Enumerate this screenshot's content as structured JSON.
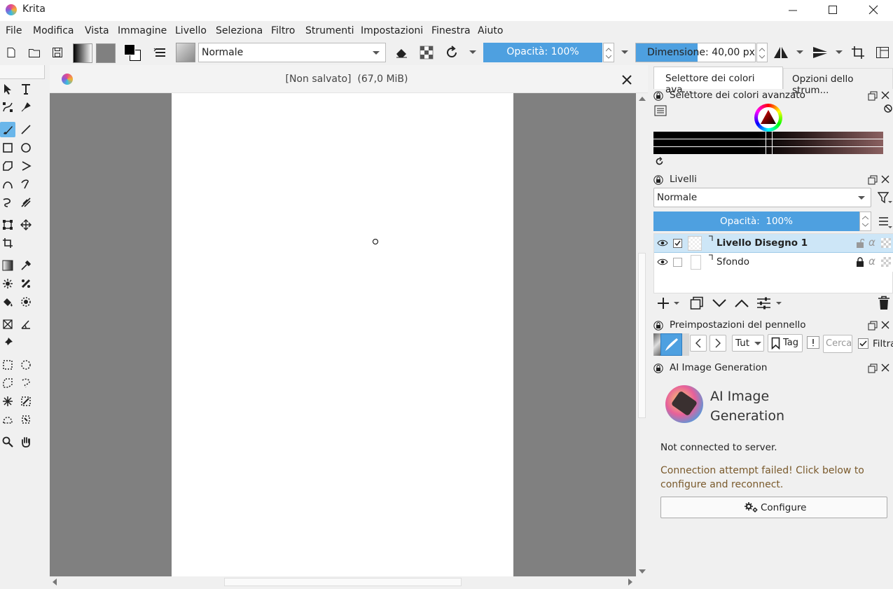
{
  "window": {
    "title": "Krita"
  },
  "menu": [
    "File",
    "Modifica",
    "Vista",
    "Immagine",
    "Livello",
    "Seleziona",
    "Filtro",
    "Strumenti",
    "Impostazioni",
    "Finestra",
    "Aiuto"
  ],
  "toolbar": {
    "blend_mode": "Normale",
    "opacity_label": "Opacità: 100%",
    "opacity_value": 1.0,
    "size_label": "Dimensione: 40,00 px"
  },
  "document": {
    "title": "[Non salvato]  (67,0 MiB)"
  },
  "dock_tabs": [
    "Selettore dei colori ava...",
    "Opzioni dello strum..."
  ],
  "color_selector": {
    "title": "Selettore dei colori avanzato"
  },
  "layers": {
    "title": "Livelli",
    "blend_mode": "Normale",
    "opacity_label": "Opacità:  100%",
    "items": [
      {
        "name": "Livello Disegno 1",
        "selected": true
      },
      {
        "name": "Sfondo",
        "selected": false
      }
    ]
  },
  "brush_presets": {
    "title": "Preimpostazioni del pennello",
    "tag_select": "Tut",
    "tag_button": "Tag",
    "search_placeholder": "Cerca",
    "filter_label": "Filtra"
  },
  "ai": {
    "dock_title": "AI Image Generation",
    "heading_line1": "AI Image",
    "heading_line2": "Generation",
    "status": "Not connected to server.",
    "error": "Connection attempt failed! Click below to configure and reconnect.",
    "configure": "Configure"
  },
  "colors": {
    "accent": "#4ea0e0",
    "selection": "#cde6f7",
    "canvas_bg": "#808080",
    "error_text": "#7a5a2c"
  }
}
